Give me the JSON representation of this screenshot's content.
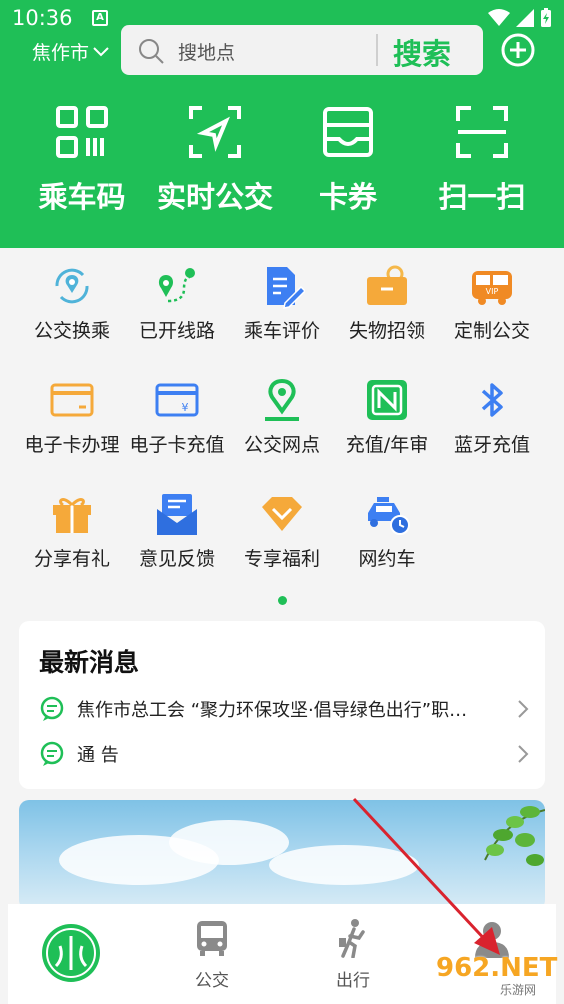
{
  "status_bar": {
    "time": "10:36",
    "badge": "A"
  },
  "header": {
    "city": "焦作市",
    "search_placeholder": "搜地点",
    "search_button": "搜索"
  },
  "top_nav": [
    {
      "label": "乘车码",
      "icon": "qr-code-icon"
    },
    {
      "label": "实时公交",
      "icon": "navigation-arrow-icon"
    },
    {
      "label": "卡券",
      "icon": "wallet-card-icon"
    },
    {
      "label": "扫一扫",
      "icon": "scan-icon"
    }
  ],
  "services": [
    {
      "label": "公交换乘",
      "icon": "transfer-location-icon"
    },
    {
      "label": "已开线路",
      "icon": "route-icon"
    },
    {
      "label": "乘车评价",
      "icon": "edit-document-icon"
    },
    {
      "label": "失物招领",
      "icon": "lost-found-box-icon"
    },
    {
      "label": "定制公交",
      "icon": "vip-bus-icon"
    },
    {
      "label": "电子卡办理",
      "icon": "card-icon"
    },
    {
      "label": "电子卡充值",
      "icon": "card-recharge-icon"
    },
    {
      "label": "公交网点",
      "icon": "location-pin-icon"
    },
    {
      "label": "充值/年审",
      "icon": "nfc-icon"
    },
    {
      "label": "蓝牙充值",
      "icon": "bluetooth-icon"
    },
    {
      "label": "分享有礼",
      "icon": "gift-icon"
    },
    {
      "label": "意见反馈",
      "icon": "feedback-mail-icon"
    },
    {
      "label": "专享福利",
      "icon": "diamond-icon"
    },
    {
      "label": "网约车",
      "icon": "taxi-icon"
    }
  ],
  "news": {
    "title": "最新消息",
    "items": [
      "焦作市总工会 “聚力环保攻坚·倡导绿色出行”职…",
      "通  告"
    ]
  },
  "tab_bar": [
    {
      "label": "",
      "icon": "app-logo-icon"
    },
    {
      "label": "公交",
      "icon": "bus-icon"
    },
    {
      "label": "出行",
      "icon": "walking-person-icon"
    },
    {
      "label": "",
      "icon": "user-profile-icon"
    }
  ],
  "watermark": {
    "text": "962.NET",
    "sub": "乐游网"
  },
  "colors": {
    "brand_green": "#1fbf57",
    "watermark_orange": "#f6a623"
  }
}
